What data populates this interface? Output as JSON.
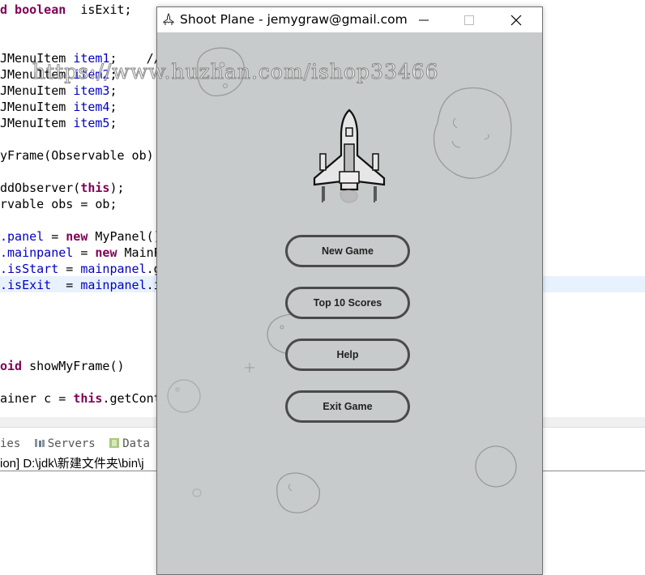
{
  "ide": {
    "code_lines": [
      {
        "parts": [
          {
            "t": "d boolean",
            "c": "kw"
          },
          {
            "t": "  isExit;",
            "c": ""
          }
        ]
      },
      {
        "parts": [
          {
            "t": "JMenuItem ",
            "c": ""
          },
          {
            "t": "item1",
            "c": "fld"
          },
          {
            "t": ";    //",
            "c": ""
          }
        ]
      },
      {
        "parts": [
          {
            "t": "JMenuItem ",
            "c": ""
          },
          {
            "t": "item2",
            "c": "fld"
          },
          {
            "t": ";",
            "c": ""
          }
        ]
      },
      {
        "parts": [
          {
            "t": "JMenuItem ",
            "c": ""
          },
          {
            "t": "item3",
            "c": "fld"
          },
          {
            "t": ";",
            "c": ""
          }
        ]
      },
      {
        "parts": [
          {
            "t": "JMenuItem ",
            "c": ""
          },
          {
            "t": "item4",
            "c": "fld"
          },
          {
            "t": ";",
            "c": ""
          }
        ]
      },
      {
        "parts": [
          {
            "t": "JMenuItem ",
            "c": ""
          },
          {
            "t": "item5",
            "c": "fld"
          },
          {
            "t": ";",
            "c": ""
          }
        ]
      },
      {
        "parts": [
          {
            "t": "yFrame(Observable ob)",
            "c": ""
          }
        ]
      },
      {
        "parts": [
          {
            "t": "ddObserver(",
            "c": ""
          },
          {
            "t": "this",
            "c": "kw"
          },
          {
            "t": ");",
            "c": ""
          }
        ]
      },
      {
        "parts": [
          {
            "t": "rvable obs = ob;",
            "c": ""
          }
        ]
      },
      {
        "parts": [
          {
            "t": ".panel",
            "c": "fld"
          },
          {
            "t": " = ",
            "c": ""
          },
          {
            "t": "new",
            "c": "kw"
          },
          {
            "t": " MyPanel()",
            "c": ""
          }
        ]
      },
      {
        "parts": [
          {
            "t": ".mainpanel",
            "c": "fld"
          },
          {
            "t": " = ",
            "c": ""
          },
          {
            "t": "new",
            "c": "kw"
          },
          {
            "t": " MainP",
            "c": ""
          }
        ]
      },
      {
        "parts": [
          {
            "t": ".isStart",
            "c": "fld"
          },
          {
            "t": " = ",
            "c": ""
          },
          {
            "t": "mainpanel",
            "c": "fld"
          },
          {
            "t": ".g",
            "c": ""
          }
        ]
      },
      {
        "parts": [
          {
            "t": ".isExit",
            "c": "fld"
          },
          {
            "t": "  = ",
            "c": ""
          },
          {
            "t": "mainpanel",
            "c": "fld"
          },
          {
            "t": ".i",
            "c": ""
          }
        ]
      },
      {
        "parts": [
          {
            "t": "oid",
            "c": "kw"
          },
          {
            "t": " showMyFrame()",
            "c": ""
          }
        ]
      },
      {
        "parts": [
          {
            "t": "ainer c = ",
            "c": ""
          },
          {
            "t": "this",
            "c": "kw"
          },
          {
            "t": ".getCont",
            "c": ""
          }
        ]
      }
    ],
    "bottom_tabs": [
      {
        "label": "ies",
        "icon": "none"
      },
      {
        "label": "Servers",
        "icon": "servers-icon"
      },
      {
        "label": "Data Sou",
        "icon": "data-source-icon"
      }
    ],
    "console_title": "ion] D:\\jdk\\新建文件夹\\bin\\j"
  },
  "watermark": "https://www.huzhan.com/ishop33466",
  "window": {
    "title": "Shoot Plane - jemygraw@gmail.com",
    "buttons": {
      "minimize": "minimize",
      "maximize": "maximize",
      "close": "close"
    }
  },
  "menu": {
    "buttons": [
      {
        "label": "New Game"
      },
      {
        "label": "Top 10 Scores"
      },
      {
        "label": "Help"
      },
      {
        "label": "Exit Game"
      }
    ]
  },
  "colors": {
    "panel_bg": "#c8cbcb",
    "button_border": "#4a4a4a",
    "keyword": "#7f0055",
    "field": "#0000c0"
  }
}
